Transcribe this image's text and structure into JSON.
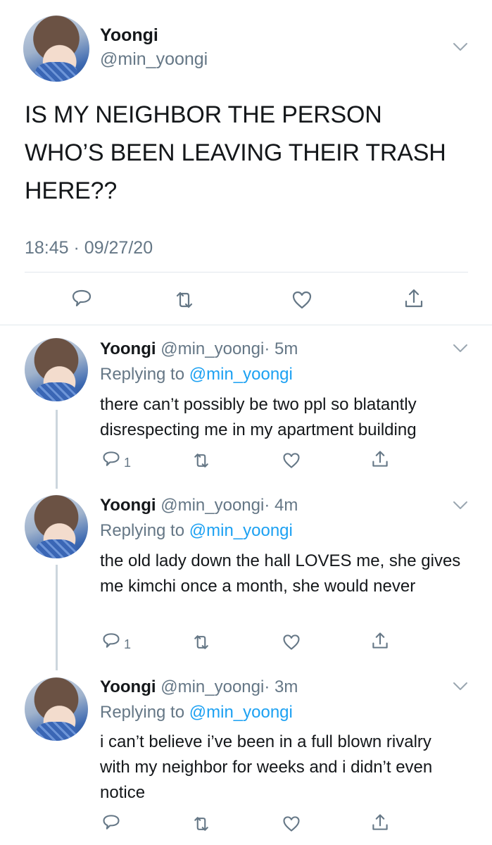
{
  "main_tweet": {
    "name": "Yoongi",
    "handle": "@min_yoongi",
    "text_lines": [
      "IS MY NEIGHBOR THE PERSON",
      "WHO’S BEEN LEAVING THEIR TRASH",
      "HERE??"
    ],
    "timestamp": "18:45 · 09/27/20"
  },
  "replies": [
    {
      "name": "Yoongi",
      "handle": "@min_yoongi",
      "time": "· 5m",
      "replying_prefix": "Replying to ",
      "replying_to": "@min_yoongi",
      "text": "there can’t possibly be two ppl so blatantly disrespecting me in my apartment building",
      "reply_count": "1"
    },
    {
      "name": "Yoongi",
      "handle": "@min_yoongi",
      "time": "· 4m",
      "replying_prefix": "Replying to ",
      "replying_to": "@min_yoongi",
      "text": "the old lady down the hall LOVES me, she gives me kimchi once a month, she would never",
      "reply_count": "1"
    },
    {
      "name": "Yoongi",
      "handle": "@min_yoongi",
      "time": "· 3m",
      "replying_prefix": "Replying to ",
      "replying_to": "@min_yoongi",
      "text": "i can’t believe i’ve been in a full blown rivalry with my neighbor for weeks and i didn’t even notice",
      "reply_count": ""
    }
  ],
  "icons": {
    "reply": "reply-icon",
    "retweet": "retweet-icon",
    "like": "like-icon",
    "share": "share-icon",
    "more": "chevron-down-icon"
  },
  "colors": {
    "link": "#1da1f2",
    "secondary_text": "#657786",
    "icon": "#657786",
    "divider": "#e1e8ed"
  }
}
